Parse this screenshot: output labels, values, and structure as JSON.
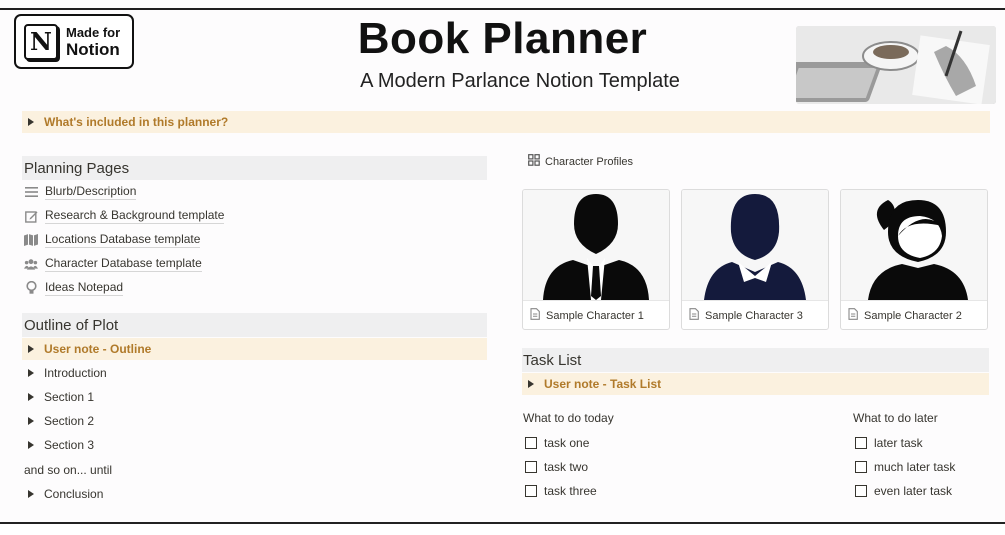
{
  "header": {
    "badge_small": "Made for",
    "badge_big": "Notion",
    "badge_logo": "N",
    "title": "Book Planner",
    "subtitle": "A Modern Parlance Notion Template",
    "photo_icon": "writing-desk-photo"
  },
  "included_toggle": "What's included in this planner?",
  "planning": {
    "heading": "Planning Pages",
    "items": [
      {
        "label": "Blurb/Description",
        "icon": "lines-icon"
      },
      {
        "label": "Research & Background template",
        "icon": "edit-icon"
      },
      {
        "label": "Locations Database template",
        "icon": "map-icon"
      },
      {
        "label": "Character Database template",
        "icon": "people-icon"
      },
      {
        "label": "Ideas Notepad",
        "icon": "lightbulb-icon"
      }
    ]
  },
  "outline": {
    "heading": "Outline of Plot",
    "note": "User note - Outline",
    "sections": [
      "Introduction",
      "Section 1",
      "Section 2",
      "Section 3"
    ],
    "continuation": "and so on... until",
    "last": "Conclusion"
  },
  "gallery": {
    "label": "Character Profiles",
    "cards": [
      {
        "caption": "Sample Character 1",
        "icon": "male-avatar-icon"
      },
      {
        "caption": "Sample Character 3",
        "icon": "female-suit-avatar-icon"
      },
      {
        "caption": "Sample Character 2",
        "icon": "female-ponytail-avatar-icon"
      }
    ]
  },
  "tasks": {
    "heading": "Task List",
    "note": "User note - Task List",
    "today_title": "What to do today",
    "today": [
      "task one",
      "task two",
      "task three"
    ],
    "later_title": "What to do later",
    "later": [
      "later task",
      "much later task",
      "even later task"
    ]
  },
  "colors": {
    "accent": "#b07a2a",
    "highlight": "#fbf1df",
    "heading_bg": "#efeff0"
  }
}
